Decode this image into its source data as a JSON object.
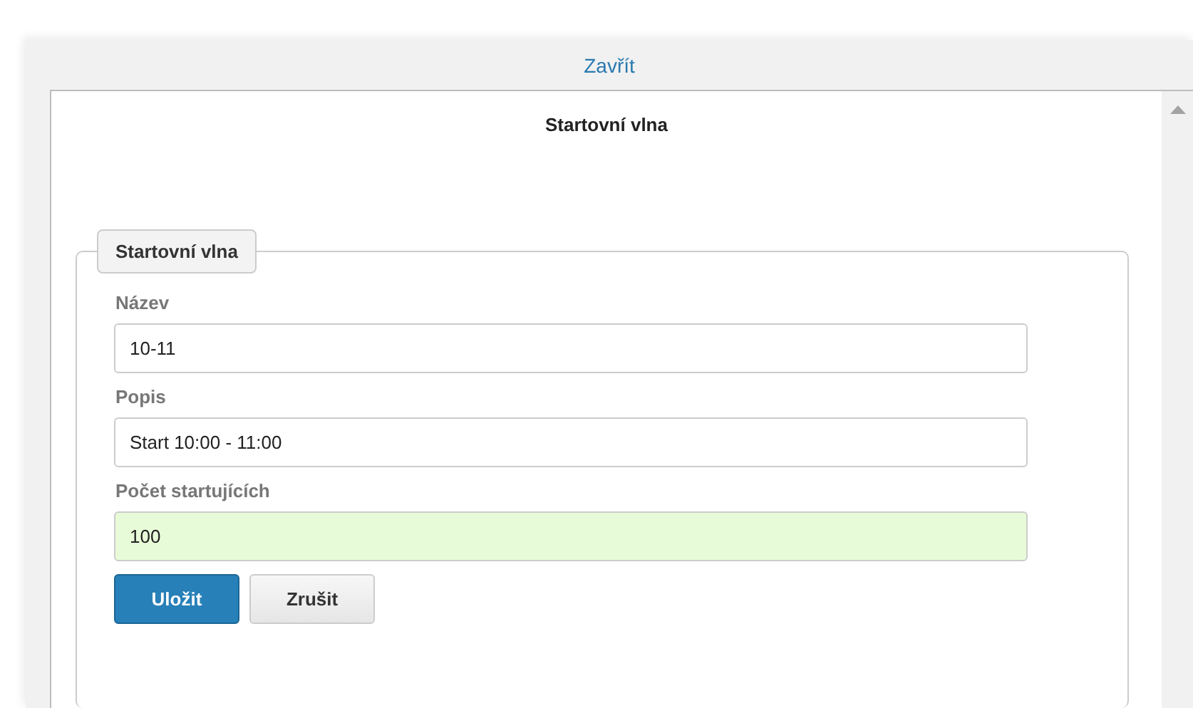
{
  "close_link": "Zavřít",
  "dialog": {
    "title": "Startovní vlna",
    "fieldset": {
      "legend": "Startovní vlna",
      "fields": [
        {
          "label": "Název",
          "value": "10-11",
          "valid": false
        },
        {
          "label": "Popis",
          "value": "Start 10:00 - 11:00",
          "valid": false
        },
        {
          "label": "Počet startujících",
          "value": "100",
          "valid": true
        }
      ],
      "buttons": [
        {
          "label": "Uložit",
          "kind": "primary"
        },
        {
          "label": "Zrušit",
          "kind": "default"
        }
      ]
    }
  }
}
